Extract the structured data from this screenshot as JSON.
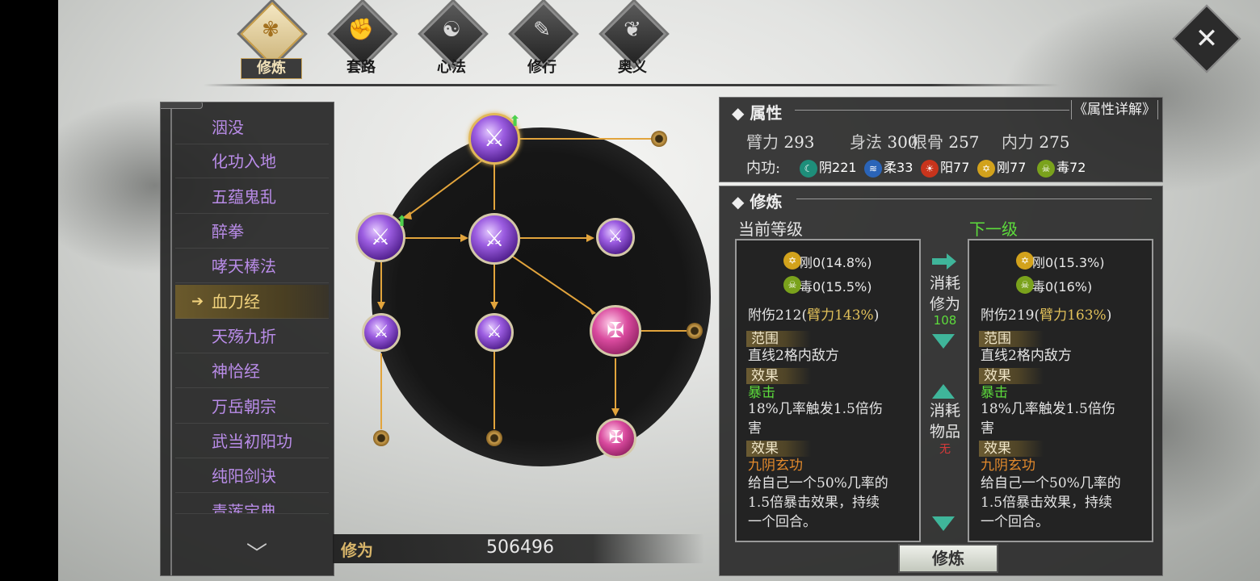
{
  "tabs": [
    {
      "label": "修炼",
      "glyph": "✾",
      "active": true
    },
    {
      "label": "套路",
      "glyph": "✊",
      "active": false
    },
    {
      "label": "心法",
      "glyph": "☯",
      "active": false
    },
    {
      "label": "修行",
      "glyph": "✎",
      "active": false
    },
    {
      "label": "奥义",
      "glyph": "❦",
      "active": false
    }
  ],
  "skill_list": {
    "items": [
      "洇没",
      "化功入地",
      "五蕴鬼乱",
      "醉拳",
      "哮天棒法",
      "血刀经",
      "天殇九折",
      "神恰经",
      "万岳朝宗",
      "武当初阳功",
      "纯阳剑诀",
      "青莲宝典"
    ],
    "selected_index": 5,
    "selected_arrow": "➔"
  },
  "xiuwei": {
    "label": "修为",
    "value": "506496"
  },
  "attributes": {
    "title": "属性",
    "detail_link": "《属性详解》",
    "stats": [
      {
        "name": "臂力",
        "value": "293"
      },
      {
        "name": "身法",
        "value": "300"
      },
      {
        "name": "根骨",
        "value": "257"
      },
      {
        "name": "内力",
        "value": "275"
      }
    ],
    "neigong_label": "内功:",
    "elements": [
      {
        "name": "阴",
        "value": "221",
        "color": "#1e8e7a"
      },
      {
        "name": "柔",
        "value": "33",
        "color": "#2a64b8"
      },
      {
        "name": "阳",
        "value": "77",
        "color": "#c8341c"
      },
      {
        "name": "刚",
        "value": "77",
        "color": "#d2a21c"
      },
      {
        "name": "毒",
        "value": "72",
        "color": "#7aa21c"
      }
    ]
  },
  "cultivation": {
    "title": "修炼",
    "current_label": "当前等级",
    "next_label": "下一级",
    "consume_xiuwei": "消耗修为",
    "consume_xiuwei_value": "108",
    "consume_item": "消耗物品",
    "consume_item_value": "无",
    "button": "修炼",
    "current": {
      "gang": "刚0(14.8%)",
      "du": "毒0(15.5%)",
      "damage_prefix": "附伤212(",
      "damage_stat": "臂力143%",
      "damage_suffix": ")",
      "range_tag": "范围",
      "range": "直线2格内敌方",
      "effect_tag": "效果",
      "effect1_name": "暴击",
      "effect1_desc1": "18%几率触发1.5倍伤",
      "effect1_desc2": "害",
      "effect2_tag": "效果",
      "effect2_name": "九阴玄功",
      "effect2_desc1": "给自己一个50%几率的",
      "effect2_desc2": "1.5倍暴击效果，持续",
      "effect2_desc3": "一个回合。"
    },
    "next": {
      "gang": "刚0(15.3%)",
      "du": "毒0(16%)",
      "damage_prefix": "附伤219(",
      "damage_stat": "臂力163%",
      "damage_suffix": ")",
      "range_tag": "范围",
      "range": "直线2格内敌方",
      "effect_tag": "效果",
      "effect1_name": "暴击",
      "effect1_desc1": "18%几率触发1.5倍伤",
      "effect1_desc2": "害",
      "effect2_tag": "效果",
      "effect2_name": "九阴玄功",
      "effect2_desc1": "给自己一个50%几率的",
      "effect2_desc2": "1.5倍暴击效果，持续",
      "effect2_desc3": "一个回合。"
    }
  },
  "icons": {
    "close": "close-x-icon",
    "scroll_down": "chevron-down-icon",
    "upgrade": "upgrade-arrow-icon"
  },
  "colors": {
    "accent_gold": "#d8b56a",
    "list_text": "#b98ce8",
    "next_level_green": "#5ddc3c"
  }
}
